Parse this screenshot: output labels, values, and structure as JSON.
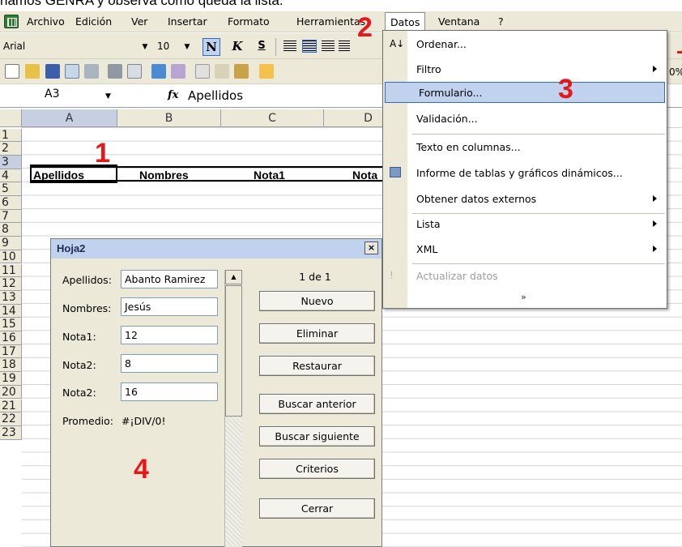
{
  "caption": "namos GENRA y observa como queda la lista.",
  "menubar": {
    "items": [
      "Archivo",
      "Edición",
      "Ver",
      "Insertar",
      "Formato",
      "Herramientas",
      "Datos",
      "Ventana",
      "?"
    ]
  },
  "font_toolbar": {
    "font": "Arial",
    "size": "10",
    "bold": "N",
    "italic": "K",
    "underline": "S"
  },
  "formula_bar": {
    "name_box": "A3",
    "fx": "fx",
    "value": "Apellidos"
  },
  "columns": [
    "A",
    "B",
    "C",
    "D"
  ],
  "rows": [
    "1",
    "2",
    "3",
    "4",
    "5",
    "6",
    "7",
    "8",
    "9",
    "10",
    "11",
    "12",
    "13",
    "14",
    "15",
    "16",
    "17",
    "18",
    "19",
    "20",
    "21",
    "22",
    "23"
  ],
  "header_row": [
    "Apellidos",
    "Nombres",
    "Nota1",
    "Nota"
  ],
  "step_numbers": [
    "1",
    "2",
    "3",
    "4"
  ],
  "dialog": {
    "title": "Hoja2",
    "close": "×",
    "fields": [
      {
        "label": "Apellidos:",
        "value": "Abanto Ramirez"
      },
      {
        "label": "Nombres:",
        "value": "Jesús"
      },
      {
        "label": "Nota1:",
        "value": "12"
      },
      {
        "label": "Nota2:",
        "value": "8"
      },
      {
        "label": "Nota2:",
        "value": "16"
      }
    ],
    "computed": {
      "label": "Promedio:",
      "value": "#¡DIV/0!"
    },
    "record": "1 de 1",
    "buttons": [
      "Nuevo",
      "Eliminar",
      "Restaurar",
      "Buscar anterior",
      "Buscar siguiente",
      "Criterios",
      "Cerrar"
    ]
  },
  "datos_menu": {
    "items": [
      {
        "label": "Ordenar...",
        "icon": "sort-icon"
      },
      {
        "label": "Filtro",
        "submenu": true
      },
      {
        "label": "Formulario...",
        "highlighted": true
      },
      {
        "label": "Validación..."
      },
      {
        "label": "Texto en columnas..."
      },
      {
        "label": "Informe de tablas y gráficos dinámicos...",
        "icon": "pivot-icon"
      },
      {
        "label": "Obtener datos externos",
        "submenu": true
      },
      {
        "label": "Lista",
        "submenu": true
      },
      {
        "label": "XML",
        "submenu": true
      },
      {
        "label": "Actualizar datos",
        "disabled": true,
        "icon": "refresh-icon"
      }
    ],
    "expand": "»"
  },
  "colors": {
    "step_number": "#e8181a",
    "highlight": "#c1d2ee",
    "toolbar": "#ece9d8"
  }
}
